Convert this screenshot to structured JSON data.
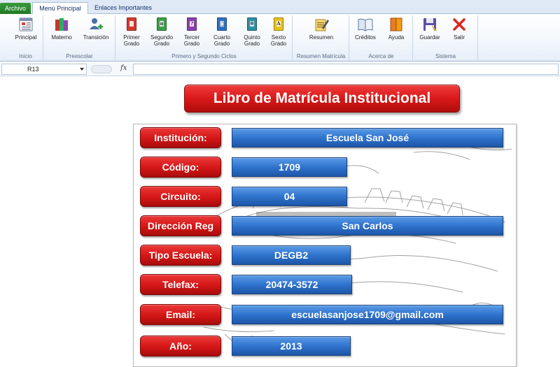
{
  "tabs": {
    "file": "Archivo",
    "main": "Menú Principal",
    "links": "Enlaces Importantes"
  },
  "ribbon": {
    "groups": {
      "inicio": "Inicio",
      "preescolar": "Preescolar",
      "ciclos": "Primero y Segundo Ciclos",
      "resumen": "Resumen Matrícula",
      "acerca": "Acerca de",
      "sistema": "Sistema"
    },
    "buttons": {
      "principal": "Principal",
      "materno": "Materno",
      "transicion": "Transición",
      "primer": "Primer\nGrado",
      "segundo": "Segundo\nGrado",
      "tercer": "Tercer\nGrado",
      "cuarto": "Cuarto\nGrado",
      "quinto": "Quinto\nGrado",
      "sexto": "Sexto\nGrado",
      "resumen": "Resumen",
      "creditos": "Créditos",
      "ayuda": "Ayuda",
      "guardar": "Guardar",
      "salir": "Salir"
    },
    "book_glyphs": {
      "segundo": "π",
      "tercer": "?",
      "cuarto": "□",
      "quinto": "θ",
      "sexto": "A"
    }
  },
  "formula_bar": {
    "cell_ref": "R13",
    "fx": "fx",
    "value": ""
  },
  "sheet": {
    "title": "Libro de Matrícula Institucional",
    "fields": [
      {
        "label": "Institución:",
        "value": "Escuela San José"
      },
      {
        "label": "Código:",
        "value": "1709"
      },
      {
        "label": "Circuito:",
        "value": "04"
      },
      {
        "label": "Dirección Reg",
        "value": "San Carlos"
      },
      {
        "label": "Tipo Escuela:",
        "value": "DEGB2"
      },
      {
        "label": "Telefax:",
        "value": "20474-3572"
      },
      {
        "label": "Email:",
        "value": "escuelasanjose1709@gmail.com"
      },
      {
        "label": "Año:",
        "value": "2013"
      }
    ]
  },
  "colors": {
    "label_red": "#d31616",
    "value_blue": "#2f73cd",
    "file_tab_green": "#2a8a2e"
  }
}
